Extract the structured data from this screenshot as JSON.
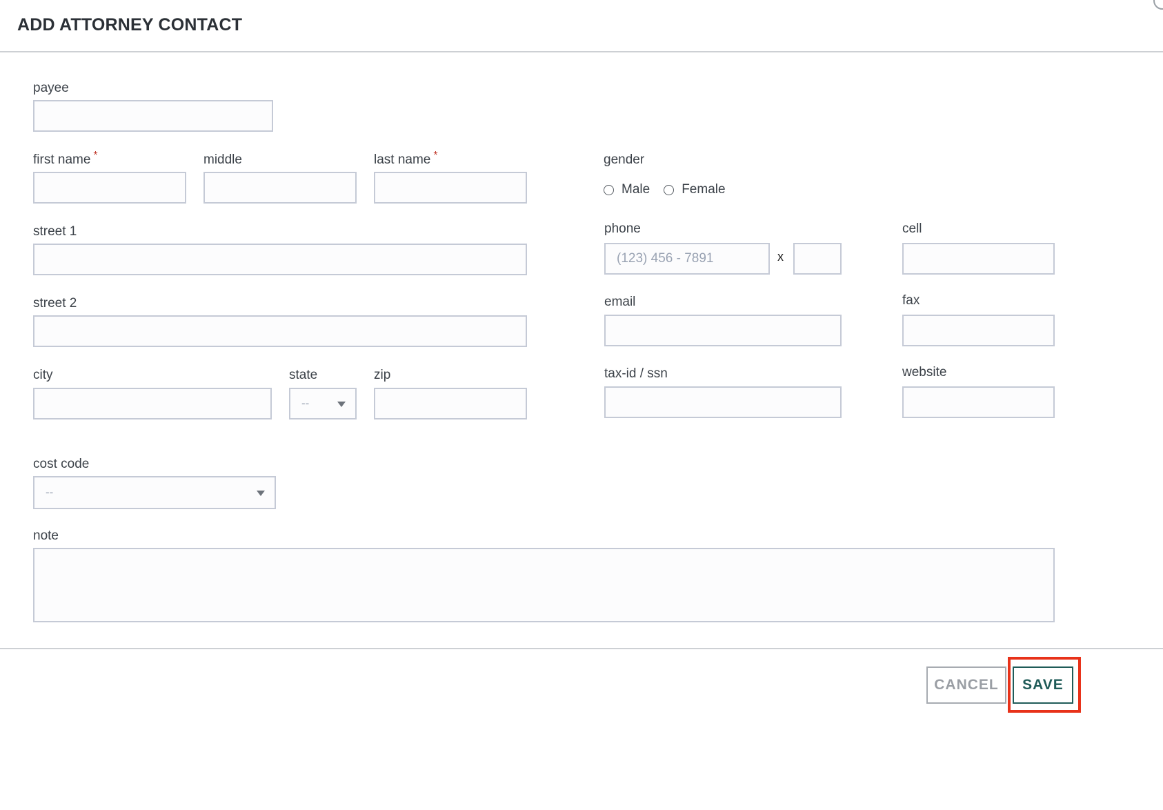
{
  "dialog": {
    "title": "ADD ATTORNEY CONTACT"
  },
  "form": {
    "payee": {
      "label": "payee",
      "value": ""
    },
    "first_name": {
      "label": "first name",
      "required_mark": "*",
      "value": ""
    },
    "middle": {
      "label": "middle",
      "value": ""
    },
    "last_name": {
      "label": "last name",
      "required_mark": "*",
      "value": ""
    },
    "gender": {
      "label": "gender",
      "options": [
        "Male",
        "Female"
      ],
      "selected": null
    },
    "street1": {
      "label": "street 1",
      "value": ""
    },
    "street2": {
      "label": "street 2",
      "value": ""
    },
    "city": {
      "label": "city",
      "value": ""
    },
    "state": {
      "label": "state",
      "selected": "--"
    },
    "zip": {
      "label": "zip",
      "value": ""
    },
    "phone": {
      "label": "phone",
      "placeholder": "(123) 456 - 7891",
      "value": "",
      "ext_separator": "x",
      "ext_value": ""
    },
    "cell": {
      "label": "cell",
      "value": ""
    },
    "email": {
      "label": "email",
      "value": ""
    },
    "fax": {
      "label": "fax",
      "value": ""
    },
    "tax_id": {
      "label": "tax-id / ssn",
      "value": ""
    },
    "website": {
      "label": "website",
      "value": ""
    },
    "cost_code": {
      "label": "cost code",
      "selected": "--"
    },
    "note": {
      "label": "note",
      "value": ""
    }
  },
  "footer": {
    "cancel_label": "CANCEL",
    "save_label": "SAVE"
  },
  "colors": {
    "accent": "#1f5b58",
    "required": "#c0392b",
    "highlight": "#e8321a",
    "field_border": "#c5cad6"
  },
  "icons": {
    "dropdown": "caret-down-icon",
    "close": "close-icon"
  }
}
